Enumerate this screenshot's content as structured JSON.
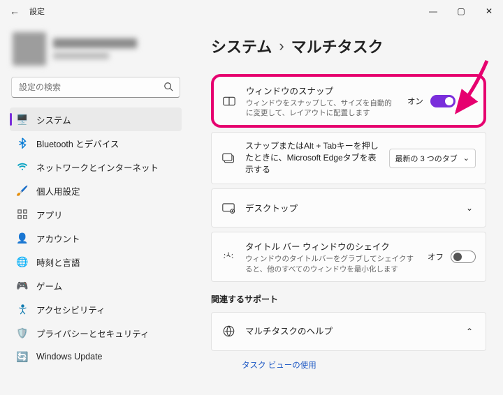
{
  "window": {
    "title": "設定"
  },
  "profile": {
    "name": "██████",
    "email": "████"
  },
  "search": {
    "placeholder": "設定の検索"
  },
  "sidebar": {
    "items": [
      {
        "label": "システム",
        "icon": "🖥️",
        "color": "#0078d4",
        "selected": true
      },
      {
        "label": "Bluetooth とデバイス",
        "icon": "bt",
        "color": "#0078d4"
      },
      {
        "label": "ネットワークとインターネット",
        "icon": "wifi",
        "color": "#0aa3c2"
      },
      {
        "label": "個人用設定",
        "icon": "🖌️",
        "color": "#c16a22"
      },
      {
        "label": "アプリ",
        "icon": "grid",
        "color": "#555"
      },
      {
        "label": "アカウント",
        "icon": "👤",
        "color": "#e08a00"
      },
      {
        "label": "時刻と言語",
        "icon": "🌐",
        "color": "#1f8cd8"
      },
      {
        "label": "ゲーム",
        "icon": "🎮",
        "color": "#3a6b3a"
      },
      {
        "label": "アクセシビリティ",
        "icon": "acc",
        "color": "#0f7bb0"
      },
      {
        "label": "プライバシーとセキュリティ",
        "icon": "🛡️",
        "color": "#5a6878"
      },
      {
        "label": "Windows Update",
        "icon": "🔄",
        "color": "#d05a00"
      }
    ]
  },
  "breadcrumb": {
    "parent": "システム",
    "sep": "›",
    "current": "マルチタスク"
  },
  "cards": {
    "snap": {
      "title": "ウィンドウのスナップ",
      "desc": "ウィンドウをスナップして、サイズを自動的に変更して、レイアウトに配置します",
      "state_label": "オン",
      "state": "on"
    },
    "edge": {
      "title": "スナップまたはAlt + Tabキーを押したときに、Microsoft Edgeタブを表示する",
      "dropdown": "最新の 3 つのタブ"
    },
    "desktop": {
      "title": "デスクトップ"
    },
    "shake": {
      "title": "タイトル バー ウィンドウのシェイク",
      "desc": "ウィンドウのタイトルバーをグラブしてシェイクすると、他のすべてのウィンドウを最小化します",
      "state_label": "オフ",
      "state": "off"
    }
  },
  "related": {
    "heading": "関連するサポート",
    "help": "マルチタスクのヘルプ",
    "more": "タスク ビューの使用"
  }
}
